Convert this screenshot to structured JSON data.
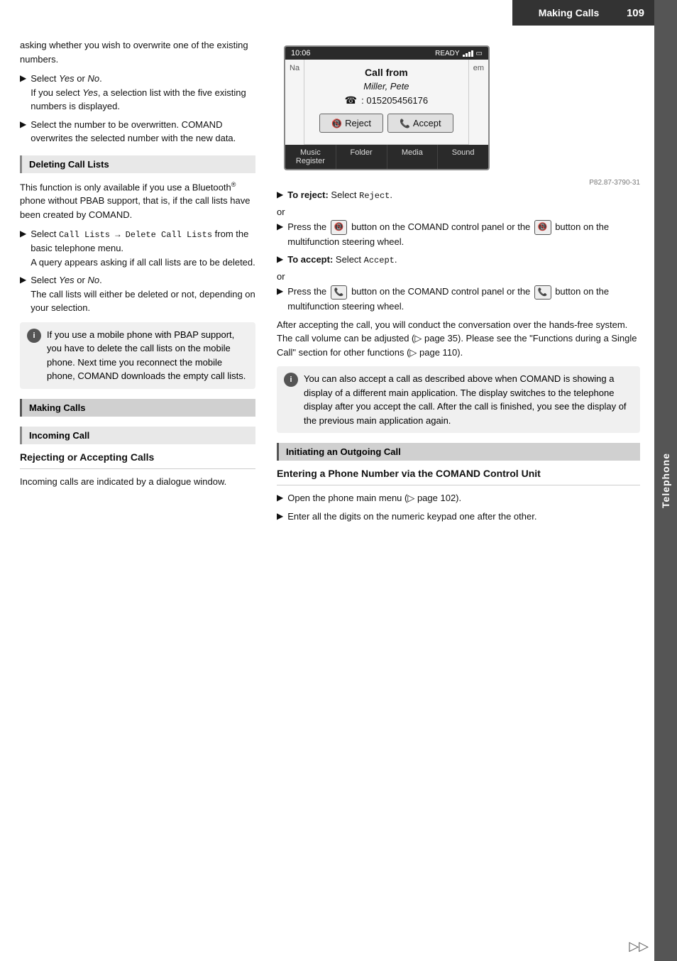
{
  "header": {
    "title": "Making Calls",
    "page_number": "109"
  },
  "sidebar": {
    "label": "Telephone"
  },
  "left_column": {
    "intro_text": "asking whether you wish to overwrite one of the existing numbers.",
    "bullets_1": [
      {
        "id": "b1",
        "text": "Select Yes or No.",
        "sub": "If you select Yes, a selection list with the five existing numbers is displayed."
      },
      {
        "id": "b2",
        "text": "Select the number to be overwritten. COMAND overwrites the selected number with the new data."
      }
    ],
    "section_deleting": {
      "title": "Deleting Call Lists",
      "intro": "This function is only available if you use a Bluetooth® phone without PBAB support, that is, if the call lists have been created by COMAND.",
      "bullets": [
        {
          "id": "d1",
          "text_code": "Select Call Lists → Delete Call Lists from the basic telephone menu.",
          "sub": "A query appears asking if all call lists are to be deleted."
        },
        {
          "id": "d2",
          "text": "Select Yes or No.",
          "sub": "The call lists will either be deleted or not, depending on your selection."
        }
      ],
      "info": "If you use a mobile phone with PBAP support, you have to delete the call lists on the mobile phone. Next time you reconnect the mobile phone, COMAND downloads the empty call lists."
    },
    "section_making_calls": {
      "title": "Making Calls"
    },
    "section_incoming": {
      "title": "Incoming Call"
    },
    "section_rejecting": {
      "title": "Rejecting or Accepting Calls",
      "intro": "Incoming calls are indicated by a dialogue window."
    }
  },
  "phone_screen": {
    "status_time": "10:06",
    "status_right": "READY",
    "nav_label": "Na",
    "nav_label2": "em",
    "call_from": "Call from",
    "caller_name": "Miller, Pete",
    "phone_number": ": 015205456176",
    "reject_label": "Reject",
    "accept_label": "Accept",
    "nav_items": [
      "Music Register",
      "Folder",
      "Media",
      "Sound"
    ],
    "caption": "P82.87-3790-31"
  },
  "right_column": {
    "to_reject": {
      "label": "To reject:",
      "text": "Select Reject."
    },
    "or1": "or",
    "press_reject": "Press the  button on the COMAND control panel or the  button on the multifunction steering wheel.",
    "to_accept": {
      "label": "To accept:",
      "text": "Select Accept."
    },
    "or2": "or",
    "press_accept": "Press the  button on the COMAND control panel or the  button on the multifunction steering wheel.",
    "after_accepting": "After accepting the call, you will conduct the conversation over the hands-free system. The call volume can be adjusted (▷ page 35). Please see the \"Functions during a Single Call\" section for other functions (▷ page 110).",
    "info_accept": "You can also accept a call as described above when COMAND is showing a display of a different main application. The display switches to the telephone display after you accept the call. After the call is finished, you see the display of the previous main application again.",
    "section_initiating": {
      "title": "Initiating an Outgoing Call"
    },
    "section_entering": {
      "title": "Entering a Phone Number via the COMAND Control Unit"
    },
    "bullets_entering": [
      {
        "id": "e1",
        "text": "Open the phone main menu (▷ page 102)."
      },
      {
        "id": "e2",
        "text": "Enter all the digits on the numeric keypad one after the other."
      }
    ]
  },
  "bottom_nav": "▷▷"
}
